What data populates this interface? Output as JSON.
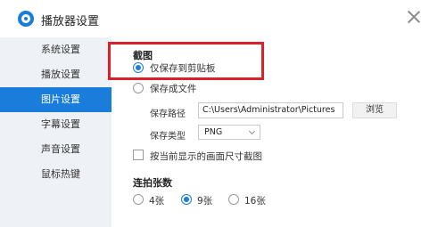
{
  "window": {
    "title": "播放器设置",
    "logo_icon": "player-logo-icon",
    "close_icon": "close-icon"
  },
  "sidebar": {
    "items": [
      {
        "label": "系统设置",
        "active": false
      },
      {
        "label": "播放设置",
        "active": false
      },
      {
        "label": "图片设置",
        "active": true
      },
      {
        "label": "字幕设置",
        "active": false
      },
      {
        "label": "声音设置",
        "active": false
      },
      {
        "label": "鼠标热键",
        "active": false
      }
    ]
  },
  "screenshot": {
    "section_title": "截图",
    "option_clipboard": "仅保存到剪贴板",
    "option_file": "保存成文件",
    "selected_option": "option_clipboard",
    "path_label": "保存路径",
    "path_value": "C:\\Users\\Administrator\\Pictures",
    "browse_label": "浏览",
    "type_label": "保存类型",
    "type_value": "PNG",
    "resize_checkbox_label": "按当前显示的画面尺寸截图",
    "resize_checked": false
  },
  "burst": {
    "section_title": "连拍张数",
    "options": [
      "4张",
      "9张",
      "16张"
    ],
    "selected": "9张"
  },
  "colors": {
    "accent": "#1a7ddc",
    "sidebar_bg": "#eef1f5",
    "highlight": "#d8222a"
  }
}
